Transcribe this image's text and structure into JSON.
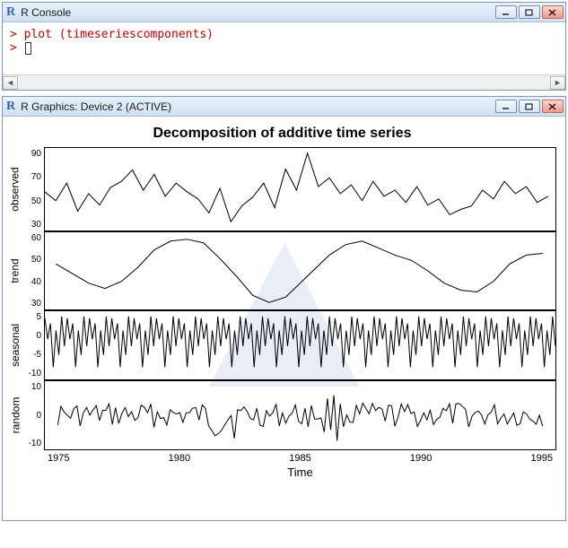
{
  "console": {
    "title": "R Console",
    "prompt": ">",
    "line1": "> plot (timeseriescomponents)",
    "line2_prompt": "> "
  },
  "graphics": {
    "title": "R Graphics: Device 2 (ACTIVE)",
    "chart_title": "Decomposition of additive time series",
    "xlabel": "Time",
    "xticks": [
      "1975",
      "1980",
      "1985",
      "1990",
      "1995"
    ]
  },
  "panels": {
    "observed": {
      "label": "observed",
      "ticks": [
        "90",
        "70",
        "50",
        "30"
      ]
    },
    "trend": {
      "label": "trend",
      "ticks": [
        "60",
        "50",
        "40",
        "30"
      ]
    },
    "seasonal": {
      "label": "seasonal",
      "ticks": [
        "5",
        "0",
        "-5",
        "-10"
      ]
    },
    "random": {
      "label": "random",
      "ticks": [
        "10",
        "0",
        "-10"
      ]
    }
  },
  "chart_data": {
    "type": "line",
    "title": "Decomposition of additive time series",
    "xlabel": "Time",
    "x_range": [
      1973,
      1996
    ],
    "xticks": [
      1975,
      1980,
      1985,
      1990,
      1995
    ],
    "series": [
      {
        "name": "observed",
        "ylim": [
          25,
          90
        ],
        "yticks": [
          30,
          50,
          70,
          90
        ],
        "x": [
          1973,
          1973.5,
          1974,
          1974.5,
          1975,
          1975.5,
          1976,
          1976.5,
          1977,
          1977.5,
          1978,
          1978.5,
          1979,
          1979.5,
          1980,
          1980.5,
          1981,
          1981.5,
          1982,
          1982.5,
          1983,
          1983.5,
          1984,
          1984.5,
          1985,
          1985.5,
          1986,
          1986.5,
          1987,
          1987.5,
          1988,
          1988.5,
          1989,
          1989.5,
          1990,
          1990.5,
          1991,
          1991.5,
          1992,
          1992.5,
          1993,
          1993.5,
          1994,
          1994.5,
          1995,
          1995.5,
          1996
        ],
        "values": [
          55,
          48,
          60,
          38,
          52,
          42,
          56,
          62,
          70,
          55,
          68,
          50,
          60,
          54,
          48,
          35,
          55,
          27,
          42,
          50,
          62,
          40,
          72,
          55,
          88,
          58,
          65,
          52,
          60,
          48,
          62,
          50,
          55,
          45,
          58,
          43,
          48,
          35,
          40,
          42,
          55,
          48,
          62,
          52,
          58,
          46,
          50
        ]
      },
      {
        "name": "trend",
        "ylim": [
          28,
          65
        ],
        "yticks": [
          30,
          40,
          50,
          60
        ],
        "x": [
          1973,
          1974,
          1975,
          1976,
          1977,
          1978,
          1979,
          1980,
          1981,
          1982,
          1983,
          1984,
          1985,
          1986,
          1987,
          1988,
          1989,
          1990,
          1991,
          1992,
          1993,
          1994,
          1995,
          1996
        ],
        "values": [
          50,
          45,
          41,
          45,
          55,
          62,
          63,
          55,
          45,
          33,
          36,
          47,
          55,
          60,
          62,
          58,
          55,
          52,
          46,
          42,
          41,
          48,
          55,
          56
        ]
      },
      {
        "name": "seasonal",
        "ylim": [
          -12,
          9
        ],
        "yticks": [
          -10,
          -5,
          0,
          5
        ],
        "x": [
          1973,
          1973.25,
          1973.5,
          1973.75,
          1974
        ],
        "period": 1,
        "pattern": [
          7,
          -2,
          5,
          -10,
          2,
          -5,
          8,
          -3
        ],
        "note": "annual seasonal cycle repeating approximately, amplitude ~[-11,8]"
      },
      {
        "name": "random",
        "ylim": [
          -14,
          14
        ],
        "yticks": [
          -10,
          0,
          10
        ],
        "x": [
          1973,
          1996
        ],
        "note": "irregular residuals fluctuating roughly within ±10, occasional spikes to ±13 near 1981 and 1986"
      }
    ]
  }
}
